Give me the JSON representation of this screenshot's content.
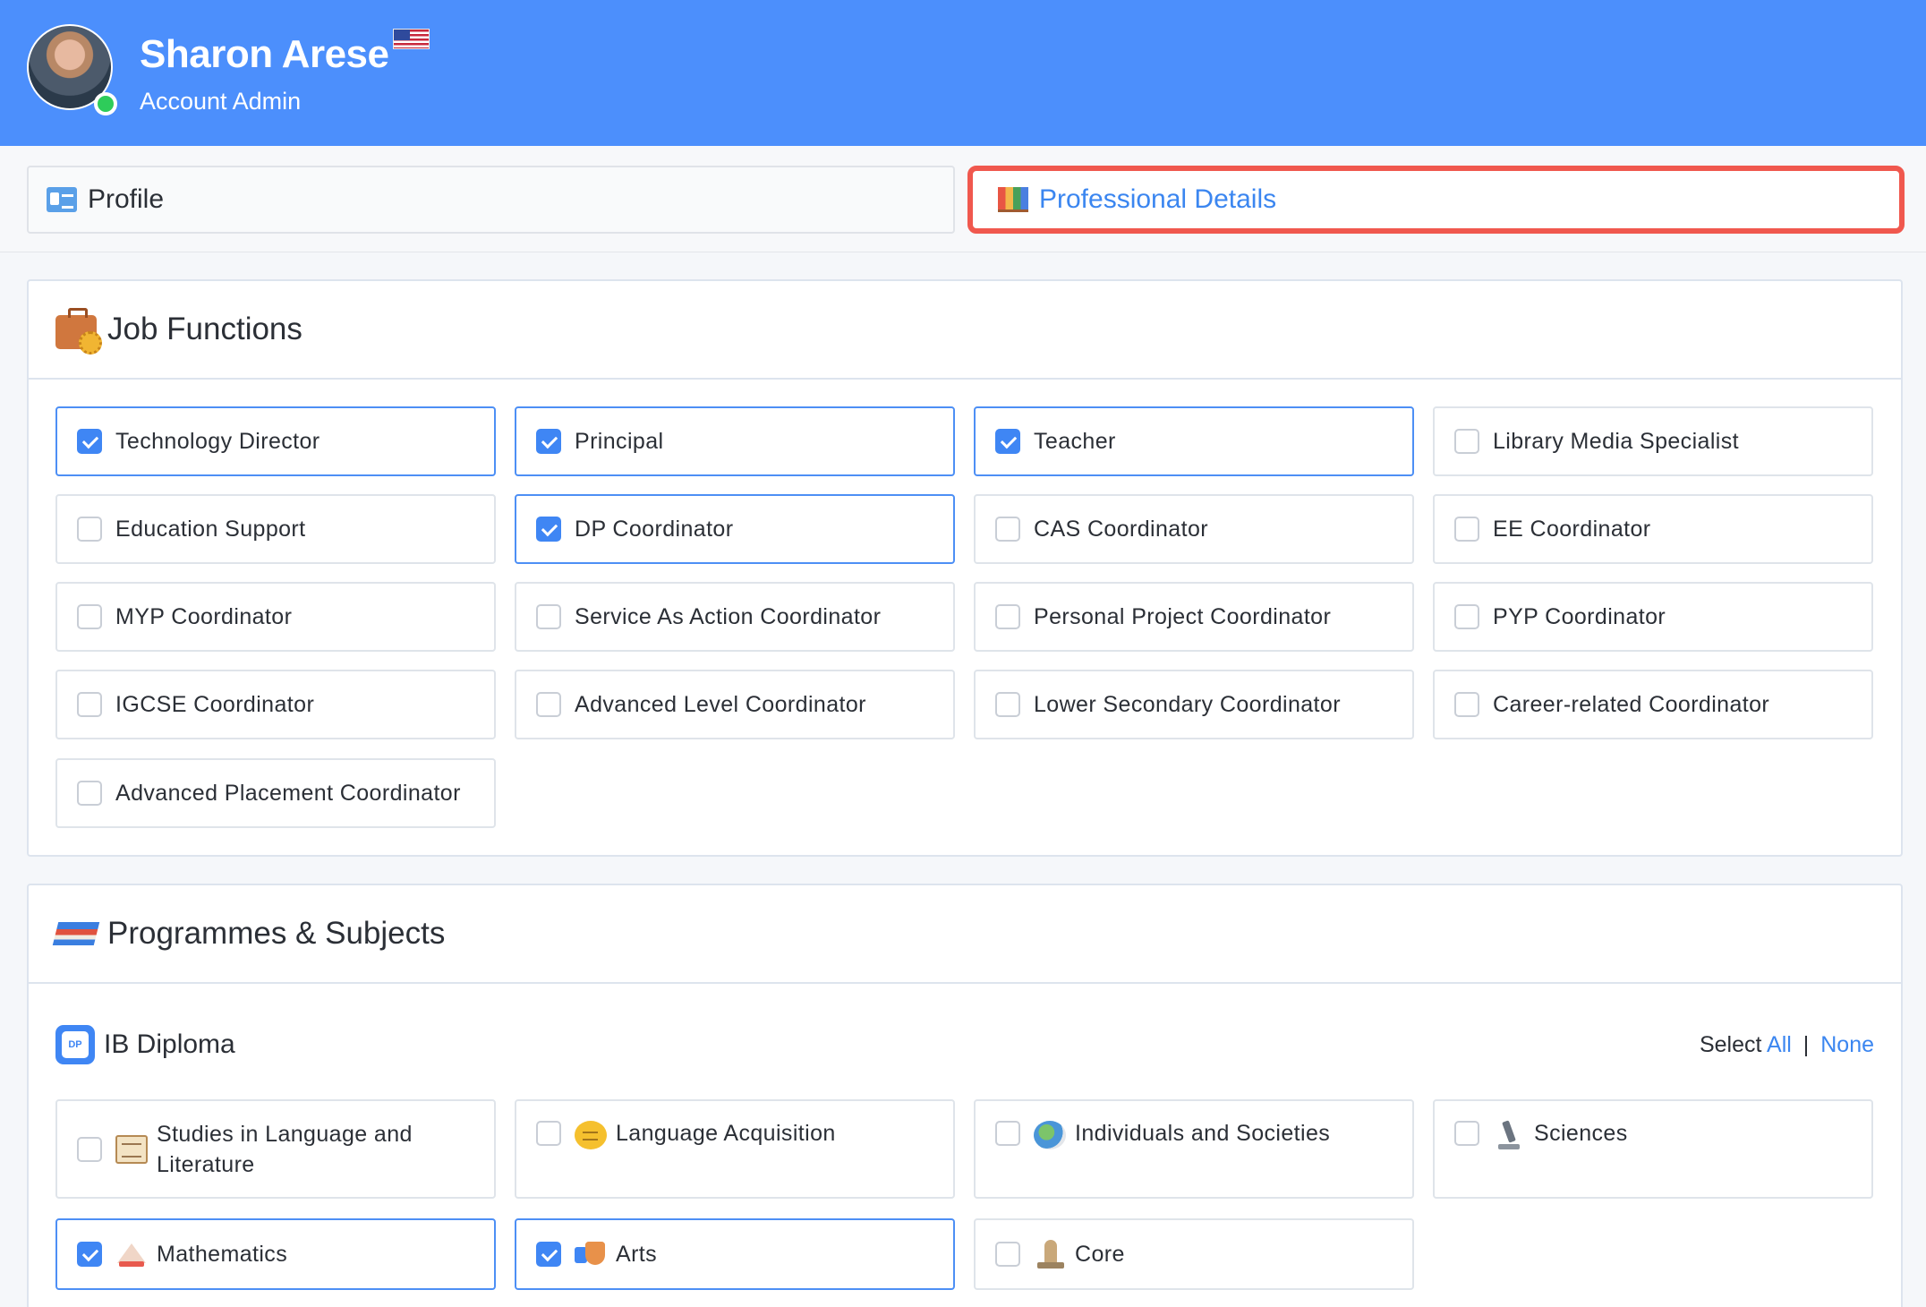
{
  "user": {
    "name": "Sharon Arese",
    "role": "Account Admin",
    "avatar_icon": "user-avatar",
    "flag_icon": "us-flag-icon",
    "status": "online"
  },
  "tabs": [
    {
      "label": "Profile",
      "icon": "id-card-icon",
      "active": false
    },
    {
      "label": "Professional Details",
      "icon": "books-icon",
      "active": true
    }
  ],
  "job_functions": {
    "title": "Job Functions",
    "icon": "briefcase-icon",
    "items": [
      {
        "label": "Technology Director",
        "checked": true
      },
      {
        "label": "Principal",
        "checked": true
      },
      {
        "label": "Teacher",
        "checked": true
      },
      {
        "label": "Library Media Specialist",
        "checked": false
      },
      {
        "label": "Education Support",
        "checked": false
      },
      {
        "label": "DP Coordinator",
        "checked": true
      },
      {
        "label": "CAS Coordinator",
        "checked": false
      },
      {
        "label": "EE Coordinator",
        "checked": false
      },
      {
        "label": "MYP Coordinator",
        "checked": false
      },
      {
        "label": "Service As Action Coordinator",
        "checked": false
      },
      {
        "label": "Personal Project Coordinator",
        "checked": false
      },
      {
        "label": "PYP Coordinator",
        "checked": false
      },
      {
        "label": "IGCSE Coordinator",
        "checked": false
      },
      {
        "label": "Advanced Level Coordinator",
        "checked": false
      },
      {
        "label": "Lower Secondary Coordinator",
        "checked": false
      },
      {
        "label": "Career-related Coordinator",
        "checked": false
      },
      {
        "label": "Advanced Placement Coordinator",
        "checked": false
      }
    ]
  },
  "programmes": {
    "title": "Programmes & Subjects",
    "icon": "books-stack-icon",
    "ib_diploma": {
      "title": "IB Diploma",
      "badge_text": "DP",
      "select_label": "Select",
      "select_all": "All",
      "select_separator": "|",
      "select_none": "None",
      "subjects": [
        {
          "label_line1": "Studies in Language and",
          "label_line2": "Literature",
          "icon": "scroll-icon",
          "checked": false
        },
        {
          "label": "Language Acquisition",
          "icon": "speech-bubble-icon",
          "checked": false
        },
        {
          "label": "Individuals and Societies",
          "icon": "globe-icon",
          "checked": false
        },
        {
          "label": "Sciences",
          "icon": "microscope-icon",
          "checked": false
        },
        {
          "label": "Mathematics",
          "icon": "triangle-ruler-icon",
          "checked": true
        },
        {
          "label": "Arts",
          "icon": "theater-masks-icon",
          "checked": true
        },
        {
          "label": "Core",
          "icon": "statue-icon",
          "checked": false
        }
      ]
    }
  }
}
